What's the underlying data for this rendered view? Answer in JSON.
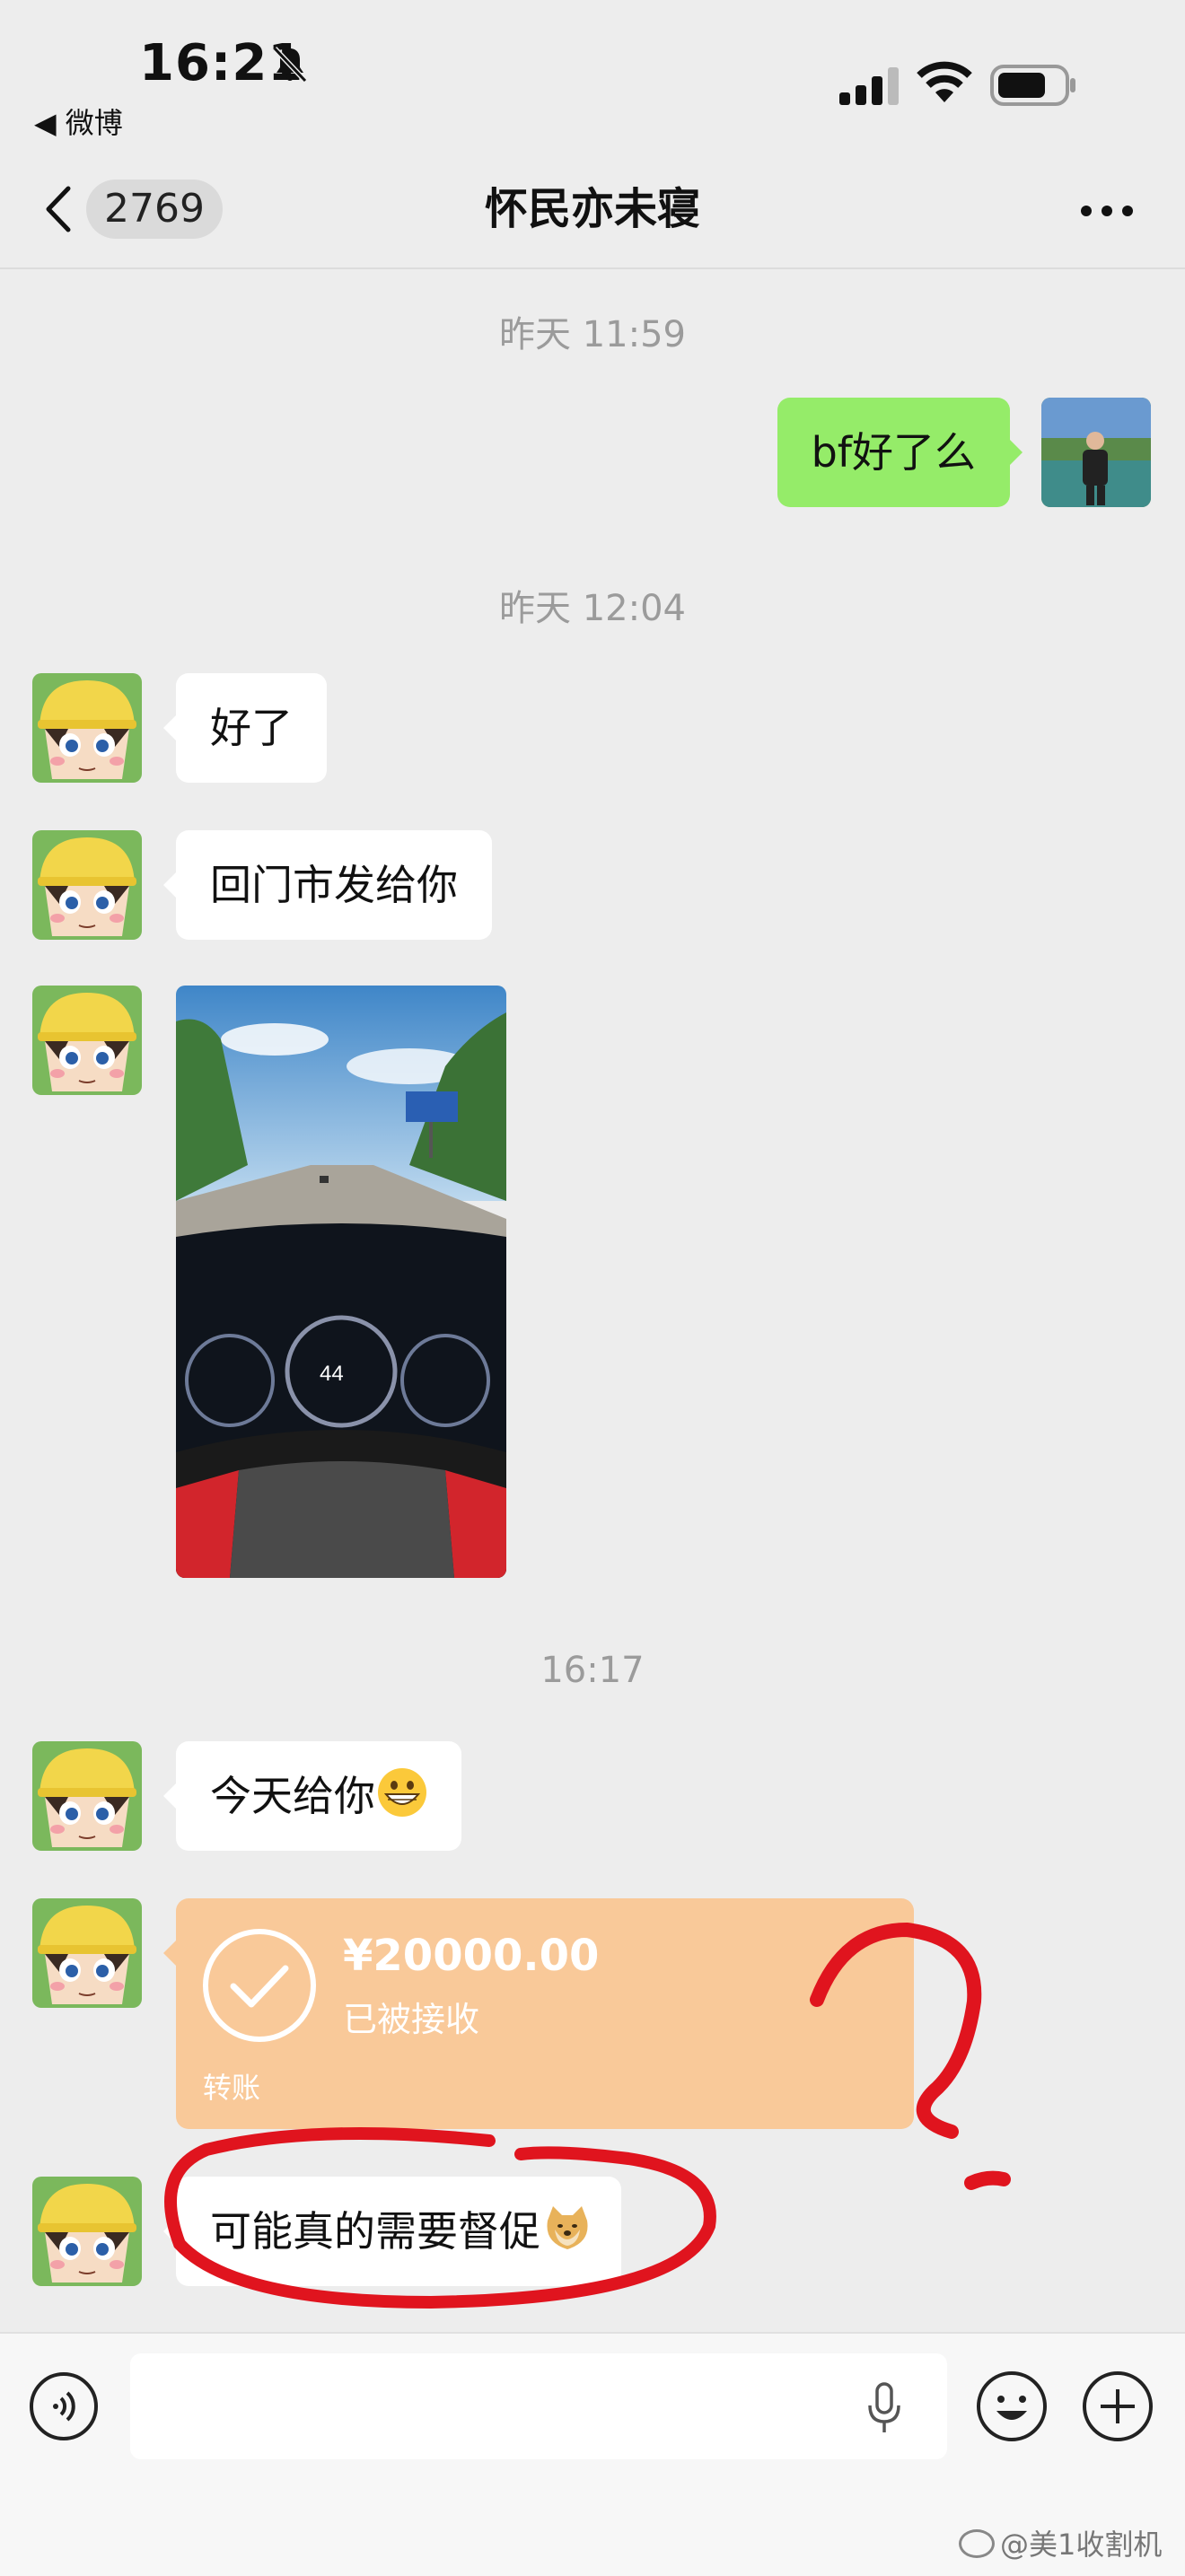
{
  "status_bar": {
    "time": "16:21",
    "back_app": "◀ 微博"
  },
  "nav": {
    "unread_count": "2769",
    "title": "怀民亦未寝"
  },
  "messages": {
    "ts1": "昨天 11:59",
    "me1": "bf好了么",
    "ts2": "昨天 12:04",
    "m1": "好了",
    "m2": "回门市发给你",
    "ts3": "16:17",
    "m4": "今天给你",
    "transfer": {
      "amount": "¥20000.00",
      "status": "已被接收",
      "label": "转账"
    },
    "m6": "可能真的需要督促"
  },
  "watermark": "@美1收割机",
  "colors": {
    "bg": "#ededed",
    "my_bubble": "#95ec69",
    "transfer": "#f9c999",
    "annotation": "#e0141e"
  }
}
